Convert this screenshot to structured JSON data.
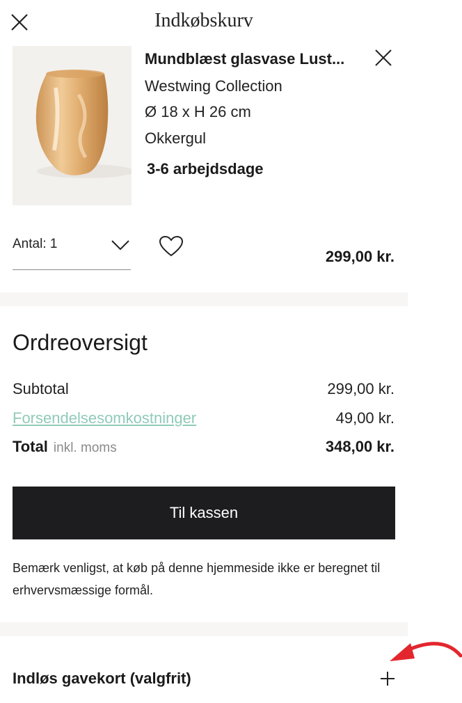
{
  "header": {
    "title": "Indkøbskurv",
    "close_icon": "close-icon"
  },
  "cart_item": {
    "name": "Mundblæst glasvase Lust...",
    "brand": "Westwing Collection",
    "dimensions": "Ø 18 x H 26 cm",
    "color": "Okkergul",
    "delivery": "3-6 arbejdsdage",
    "quantity_label": "Antal: 1",
    "price": "299,00 kr.",
    "image_icon": "glass-vase-image",
    "remove_icon": "close-icon",
    "wishlist_icon": "heart-icon",
    "dropdown_icon": "chevron-down-icon"
  },
  "summary": {
    "title": "Ordreoversigt",
    "subtotal_label": "Subtotal",
    "subtotal_value": "299,00 kr.",
    "shipping_label": "Forsendelsesomkostninger",
    "shipping_value": "49,00 kr.",
    "total_label": "Total",
    "total_note": "inkl. moms",
    "total_value": "348,00 kr.",
    "link_color": "#8fcab8"
  },
  "checkout": {
    "button_label": "Til kassen",
    "button_color": "#1d1d1f",
    "note": "Bemærk venligst, at køb på denne hjemmeside ikke er beregnet til erhvervsmæssige formål."
  },
  "gift_card": {
    "label": "Indløs gavekort (valgfrit)",
    "expand_icon": "plus-icon",
    "annotation_icon": "red-arrow-icon",
    "annotation_color": "#e3262e"
  }
}
